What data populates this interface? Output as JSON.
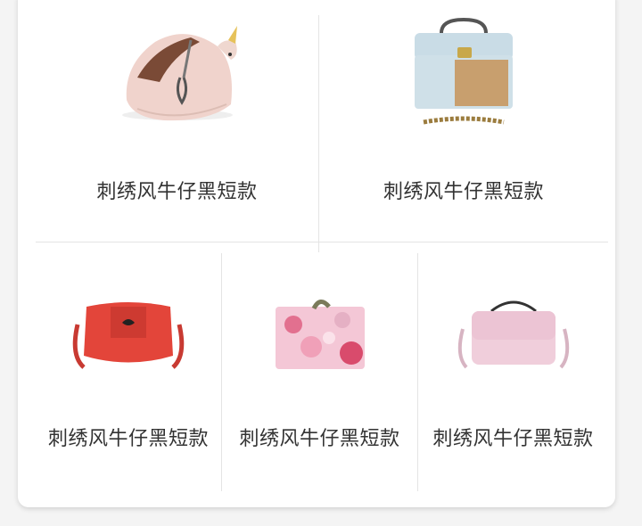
{
  "products": [
    {
      "name": "刺绣风牛仔黑短款",
      "image": "unicorn-pouch"
    },
    {
      "name": "刺绣风牛仔黑短款",
      "image": "blue-cork-bag"
    },
    {
      "name": "刺绣风牛仔黑短款",
      "image": "red-saddle-bag"
    },
    {
      "name": "刺绣风牛仔黑短款",
      "image": "floral-clutch"
    },
    {
      "name": "刺绣风牛仔黑短款",
      "image": "pink-handbag"
    }
  ],
  "colors": {
    "card": "#ffffff",
    "background": "#f4f4f4",
    "text": "#333333",
    "divider": "#e4e4e4"
  }
}
